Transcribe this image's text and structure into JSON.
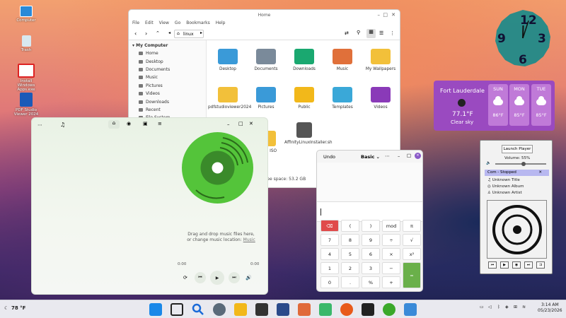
{
  "desktop": {
    "icons": [
      {
        "label": "Computer"
      },
      {
        "label": "Trash"
      },
      {
        "label": "Install Windows Apps.exe"
      },
      {
        "label": "PDF Studio Viewer 2024"
      }
    ]
  },
  "clock": {
    "hours": 12,
    "minutes": 3,
    "digit_12": "12",
    "digit_3": "3",
    "digit_6": "6",
    "digit_9": "9"
  },
  "weather": {
    "city": "Fort Lauderdale",
    "temp": "77.1°F",
    "condition": "Clear sky",
    "days": [
      {
        "day": "SUN",
        "temp": "86°F"
      },
      {
        "day": "MON",
        "temp": "85°F"
      },
      {
        "day": "TUE",
        "temp": "85°F"
      }
    ],
    "colors": {
      "bg": "#9a4ac0",
      "day_bg": "#c07ad8"
    }
  },
  "file_manager": {
    "title": "Home",
    "menu": [
      "File",
      "Edit",
      "View",
      "Go",
      "Bookmarks",
      "Help"
    ],
    "location": "linux",
    "sidebar_header": "My Computer",
    "sidebar_items": [
      "Home",
      "Desktop",
      "Documents",
      "Music",
      "Pictures",
      "Videos",
      "Downloads",
      "Recent",
      "File System"
    ],
    "files": [
      {
        "name": "Desktop",
        "color": "#3a9ad8"
      },
      {
        "name": "Documents",
        "color": "#7a8a9a"
      },
      {
        "name": "Downloads",
        "color": "#1aa870"
      },
      {
        "name": "Music",
        "color": "#e0703a"
      },
      {
        "name": "My Wallpapers",
        "color": "#f2c03a"
      },
      {
        "name": "pdfstudioviewer2024",
        "color": "#f2c03a"
      },
      {
        "name": "Pictures",
        "color": "#3a9ad8"
      },
      {
        "name": "Public",
        "color": "#f2b81a"
      },
      {
        "name": "Templates",
        "color": "#3aa8d8"
      },
      {
        "name": "Videos",
        "color": "#8a3ab8"
      },
      {
        "name": "Studio ISO",
        "color": "#f2c03a"
      },
      {
        "name": "AffinityLinuxInstaller.sh",
        "color": "#555"
      }
    ],
    "status": "Free space: 53.2 GB"
  },
  "music_player": {
    "drop_text": "Drag and drop music files here,",
    "change_text": "or change music location:",
    "link": "Music",
    "time_start": "0:00",
    "time_end": "0:00",
    "accent": "#54c43a"
  },
  "calculator": {
    "undo": "Undo",
    "mode": "Basic",
    "keys": [
      [
        "⌫",
        "(",
        ")",
        "mod",
        "π"
      ],
      [
        "7",
        "8",
        "9",
        "÷",
        "√"
      ],
      [
        "4",
        "5",
        "6",
        "×",
        "x²"
      ],
      [
        "1",
        "2",
        "3",
        "−",
        "="
      ],
      [
        "0",
        ".",
        "%",
        "+",
        ""
      ]
    ]
  },
  "media_widget": {
    "launch": "Launch Player",
    "volume": "Volume: 55%",
    "volume_level": 0.55,
    "source": "Com - Stopped",
    "title": "Unknown Title",
    "album": "Unknown Album",
    "artist": "Unknown Artist"
  },
  "taskbar": {
    "weather": "78 °F",
    "time": "3:14 AM",
    "date": "05/23/2026"
  }
}
